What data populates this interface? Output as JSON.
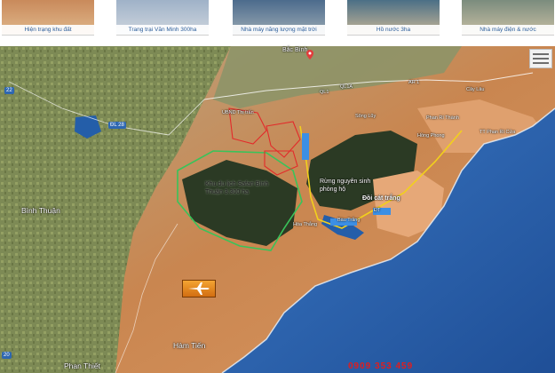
{
  "thumbnails": [
    {
      "caption": "Hiện trạng khu đất",
      "colors": [
        "#c98a5b",
        "#e0b88c"
      ]
    },
    {
      "caption": "Trang trại Văn Minh 300ha",
      "colors": [
        "#9fb2c8",
        "#cfd6de"
      ]
    },
    {
      "caption": "Nhà máy năng lượng mặt trời",
      "colors": [
        "#4c6b8c",
        "#9aa9b3"
      ]
    },
    {
      "caption": "Hồ nước 3ha",
      "colors": [
        "#4b6f86",
        "#c7b697"
      ]
    },
    {
      "caption": "Nhà máy điện & nước",
      "colors": [
        "#7b8c7d",
        "#c8bfa5"
      ]
    }
  ],
  "map": {
    "colors": {
      "sea": "#2c67b4",
      "forest": "#2b3a24",
      "land": "#c98650",
      "sand": "#e6a878",
      "boundary_green": "#39c35a",
      "boundary_red": "#e32a2a",
      "road_yellow": "#f2d01c",
      "road_white": "#ffffff",
      "lake": "#245ea9"
    },
    "labels": {
      "binh_thuan": "Bình Thuận",
      "safari": "Khu du lịch Safari Bình Thuận 3.300 ha",
      "rung": "Rừng nguyên sinh phòng hộ",
      "doi_cat": "Đồi cát trắng",
      "ham_tien": "Hàm Tiến",
      "phan_thiet": "Phan Thiết",
      "ubnd": "UBND Thị trấn",
      "bau_trang": "Bàu Trắng",
      "tt_phan_ri_cua": "TT Phan Rí Cửa",
      "phan_ri_thanh": "Phan Rí Thành",
      "song_luy": "Sông Lũy",
      "hoa_thang": "Hòa Thắng",
      "hong_phong": "Hồng Phong",
      "cay_lau": "Cây Lâu",
      "bac_binh": "Bắc Bình",
      "ql1": "QL1",
      "ql1a": "QL1A",
      "ah1": "AH 1",
      "dt": "ĐT"
    },
    "road_shields": {
      "r22": "22",
      "dl28": "ĐL 28",
      "r20": "20"
    },
    "icons": {
      "airport": "airport-icon",
      "pin": "location-pin-icon",
      "layers": "layers-menu-icon"
    },
    "hotline": "0909 353 459"
  }
}
